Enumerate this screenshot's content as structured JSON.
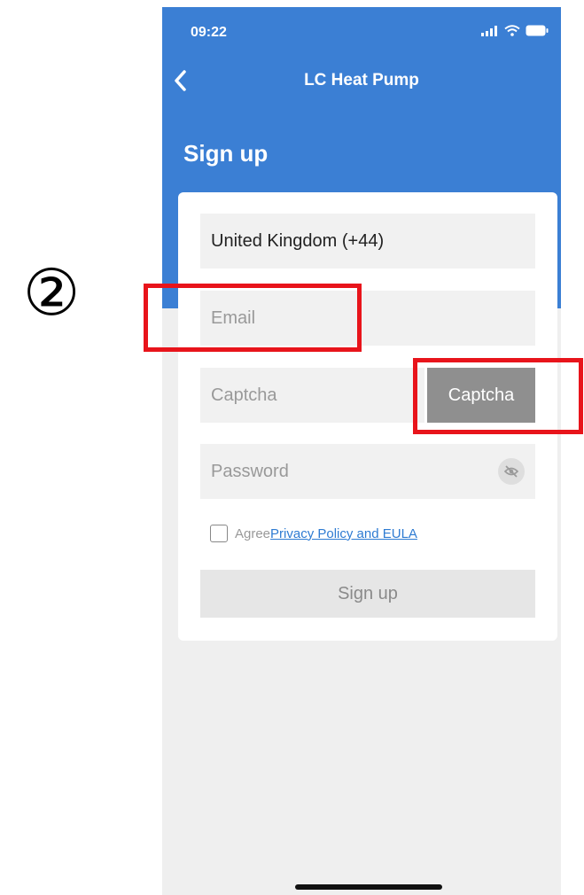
{
  "step_marker": "②",
  "status_bar": {
    "time": "09:22"
  },
  "nav": {
    "title": "LC Heat Pump"
  },
  "page": {
    "title": "Sign up"
  },
  "form": {
    "country_value": "United Kingdom (+44)",
    "email_placeholder": "Email",
    "captcha_placeholder": "Captcha",
    "captcha_button_label": "Captcha",
    "password_placeholder": "Password",
    "agree_label": "Agree",
    "policy_link": "Privacy Policy and EULA",
    "signup_button_label": "Sign up"
  },
  "colors": {
    "header_blue": "#3b7fd4",
    "highlight_red": "#e8141b",
    "captcha_button_gray": "#8f8f8f",
    "link_blue": "#2e7bd2"
  }
}
